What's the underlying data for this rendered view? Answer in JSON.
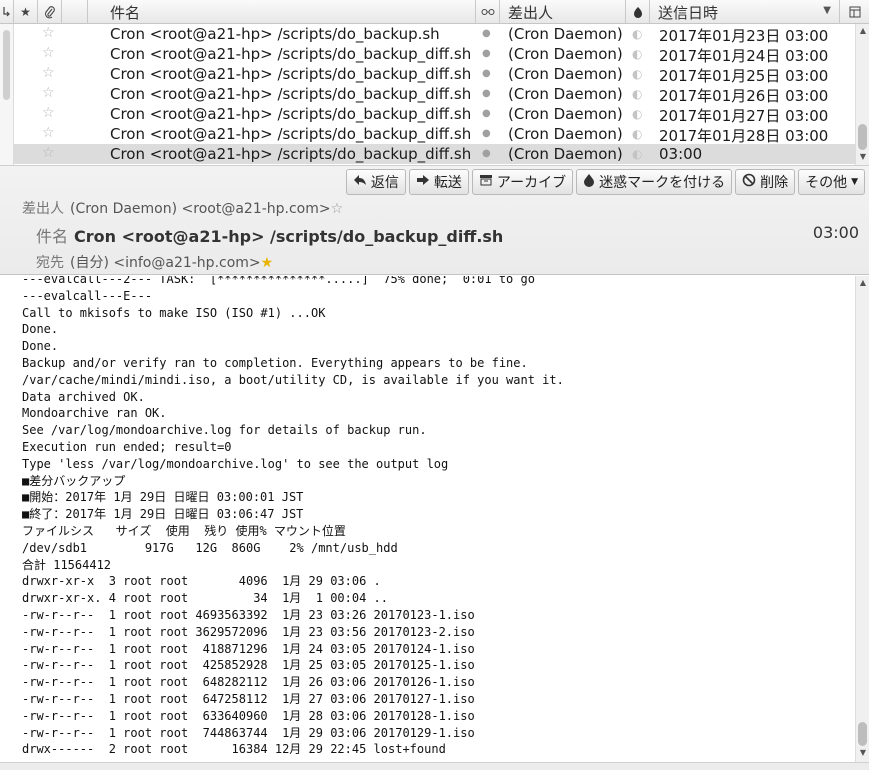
{
  "list": {
    "columns": {
      "thread_icon": "thread-icon",
      "star_icon": "star-icon",
      "attach_icon": "attachment-icon",
      "subject": "件名",
      "read_icon": "read-status-icon",
      "sender": "差出人",
      "junk_icon": "junk-icon",
      "date": "送信日時",
      "sort_icon": "sort-descending-icon",
      "picker_icon": "column-picker-icon"
    },
    "rows": [
      {
        "subject": "Cron <root@a21-hp> /scripts/do_backup.sh",
        "sender": "(Cron Daemon)",
        "date": "2017年01月23日 03:00",
        "selected": false
      },
      {
        "subject": "Cron <root@a21-hp> /scripts/do_backup_diff.sh",
        "sender": "(Cron Daemon)",
        "date": "2017年01月24日 03:00",
        "selected": false
      },
      {
        "subject": "Cron <root@a21-hp> /scripts/do_backup_diff.sh",
        "sender": "(Cron Daemon)",
        "date": "2017年01月25日 03:00",
        "selected": false
      },
      {
        "subject": "Cron <root@a21-hp> /scripts/do_backup_diff.sh",
        "sender": "(Cron Daemon)",
        "date": "2017年01月26日 03:00",
        "selected": false
      },
      {
        "subject": "Cron <root@a21-hp> /scripts/do_backup_diff.sh",
        "sender": "(Cron Daemon)",
        "date": "2017年01月27日 03:00",
        "selected": false
      },
      {
        "subject": "Cron <root@a21-hp> /scripts/do_backup_diff.sh",
        "sender": "(Cron Daemon)",
        "date": "2017年01月28日 03:00",
        "selected": false
      },
      {
        "subject": "Cron <root@a21-hp> /scripts/do_backup_diff.sh",
        "sender": "(Cron Daemon)",
        "date": "03:00",
        "selected": true
      }
    ]
  },
  "toolbar": {
    "reply": "返信",
    "forward": "転送",
    "archive": "アーカイブ",
    "junk": "迷惑マークを付ける",
    "delete": "削除",
    "other": "その他"
  },
  "header": {
    "from_label": "差出人",
    "from_value": "(Cron Daemon) <root@a21-hp.com>",
    "subject_label": "件名",
    "subject_value": "Cron <root@a21-hp> /scripts/do_backup_diff.sh",
    "time": "03:00",
    "to_label": "宛先",
    "to_value": "(自分) <info@a21-hp.com>"
  },
  "body": {
    "lines": [
      "---evalcall---2--- TASK:  [***************.....]  75% done;  0:01 to go",
      "---evalcall---E---",
      "Call to mkisofs to make ISO (ISO #1) ...OK",
      "Done.",
      "Done.",
      "Backup and/or verify ran to completion. Everything appears to be fine.",
      "/var/cache/mindi/mindi.iso, a boot/utility CD, is available if you want it.",
      "Data archived OK.",
      "Mondoarchive ran OK.",
      "See /var/log/mondoarchive.log for details of backup run.",
      "Execution run ended; result=0",
      "Type 'less /var/log/mondoarchive.log' to see the output log",
      "■差分バックアップ",
      "■開始：2017年 1月 29日 日曜日 03:00:01 JST",
      "■終了：2017年 1月 29日 日曜日 03:06:47 JST",
      "ファイルシス   サイズ  使用  残り 使用% マウント位置",
      "/dev/sdb1        917G   12G  860G    2% /mnt/usb_hdd",
      "合計 11564412",
      "drwxr-xr-x  3 root root       4096  1月 29 03:06 .",
      "drwxr-xr-x. 4 root root         34  1月  1 00:04 ..",
      "-rw-r--r--  1 root root 4693563392  1月 23 03:26 20170123-1.iso",
      "-rw-r--r--  1 root root 3629572096  1月 23 03:56 20170123-2.iso",
      "-rw-r--r--  1 root root  418871296  1月 24 03:05 20170124-1.iso",
      "-rw-r--r--  1 root root  425852928  1月 25 03:05 20170125-1.iso",
      "-rw-r--r--  1 root root  648282112  1月 26 03:06 20170126-1.iso",
      "-rw-r--r--  1 root root  647258112  1月 27 03:06 20170127-1.iso",
      "-rw-r--r--  1 root root  633640960  1月 28 03:06 20170128-1.iso",
      "-rw-r--r--  1 root root  744863744  1月 29 03:06 20170129-1.iso",
      "drwx------  2 root root      16384 12月 29 22:45 lost+found"
    ]
  }
}
